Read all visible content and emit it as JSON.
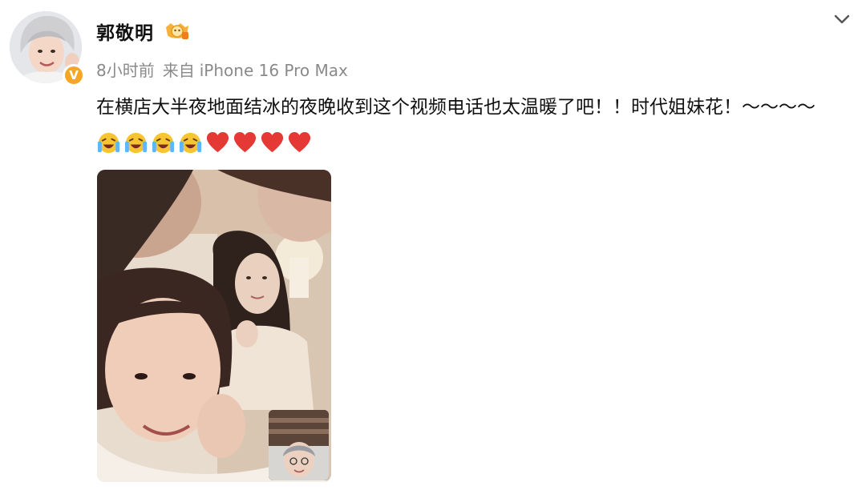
{
  "user": {
    "name": "郭敬明",
    "avatar_icon": "user-avatar",
    "verified_icon": "verified-v-badge",
    "verified_letter": "V",
    "level_icon": "weibo-level-badge"
  },
  "meta": {
    "time": "8小时前",
    "source_prefix": "来自",
    "device": "iPhone 16 Pro Max"
  },
  "post": {
    "text": "在横店大半夜地面结冰的夜晚收到这个视频电话也太温暖了吧！！时代姐妹花！～～～～",
    "emojis": [
      "laugh-cry-emoji",
      "laugh-cry-emoji",
      "laugh-cry-emoji",
      "laugh-cry-emoji",
      "red-heart-emoji",
      "red-heart-emoji",
      "red-heart-emoji",
      "red-heart-emoji"
    ]
  },
  "media": {
    "type": "video-call-screenshot",
    "pip": "self-view-thumbnail"
  },
  "controls": {
    "menu_icon": "chevron-down-icon"
  },
  "colors": {
    "text_primary": "#111111",
    "text_secondary": "#8a8a8a",
    "verified_orange": "#f5a623",
    "heart_red": "#e53935",
    "emoji_yellow": "#f7c531"
  }
}
